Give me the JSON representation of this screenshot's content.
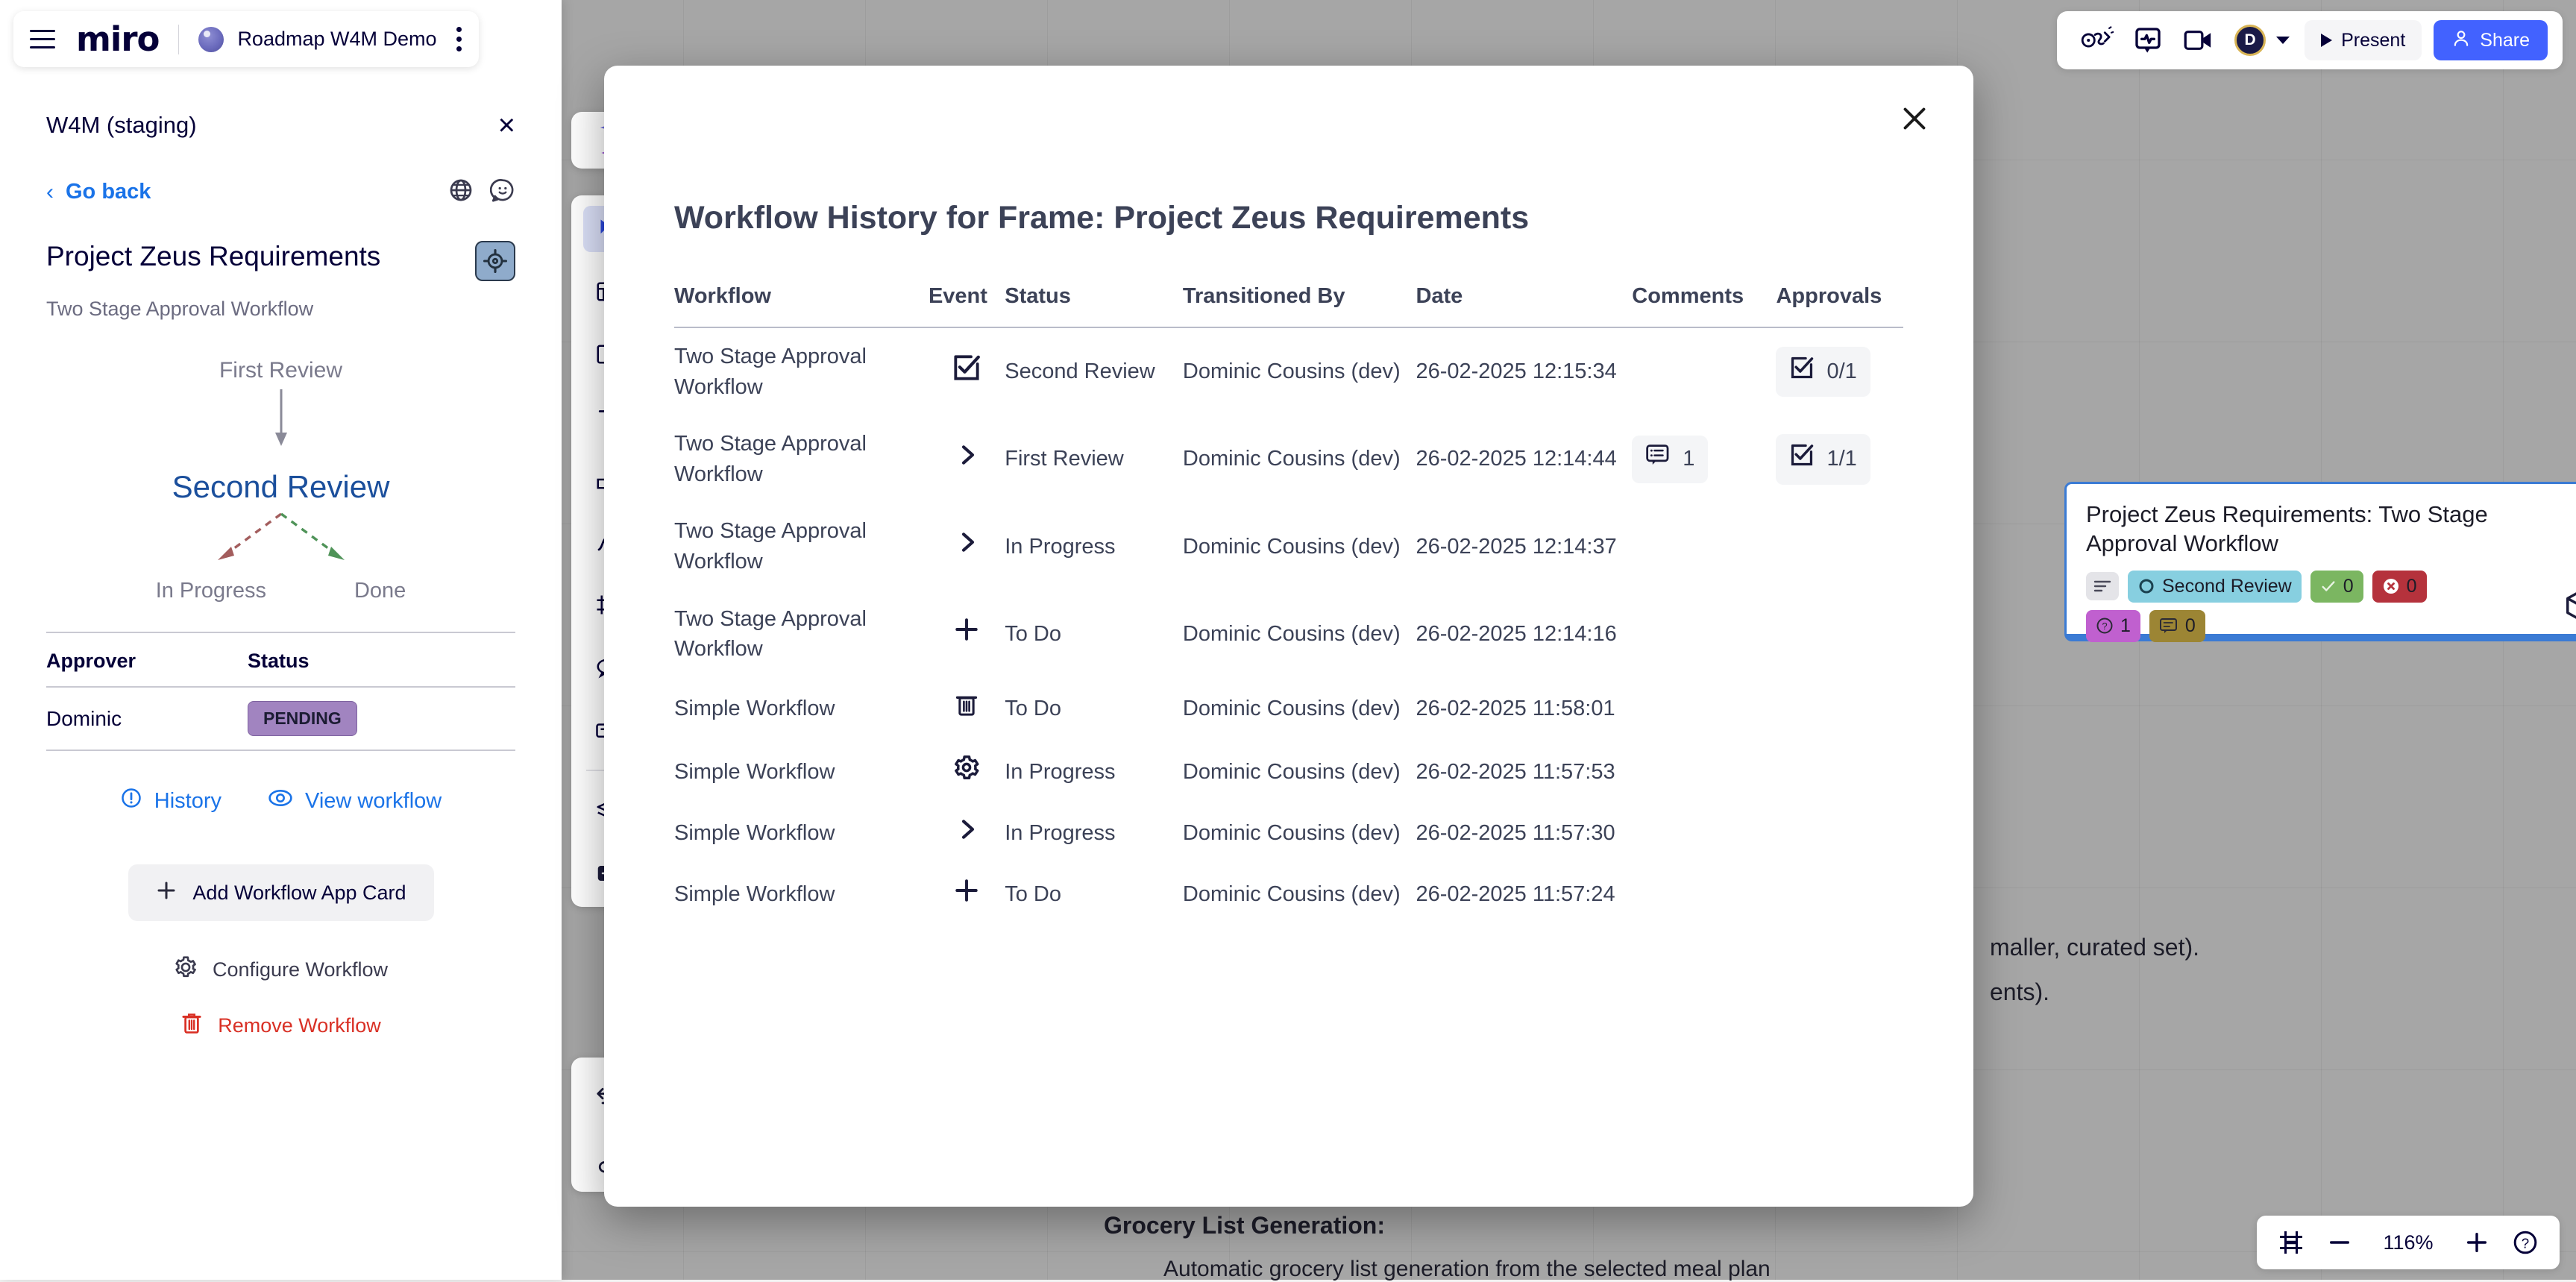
{
  "topbar": {
    "logo": "miro",
    "board_title": "Roadmap W4M Demo",
    "user_initial": "D",
    "present_label": "Present",
    "share_label": "Share",
    "icons": [
      "hamburger-icon",
      "board-thumbnail-icon",
      "kebab-menu-icon",
      "celebration-icon",
      "activity-comment-icon",
      "video-call-icon",
      "avatar",
      "chevron-down-icon",
      "play-icon",
      "person-icon"
    ]
  },
  "sidebar": {
    "app_title": "W4M (staging)",
    "close_icon": "×",
    "go_back": "Go back",
    "frame_title": "Project Zeus Requirements",
    "workflow_name": "Two Stage Approval Workflow",
    "flow": {
      "previous_state": "First Review",
      "current_state": "Second Review",
      "next_states": [
        "In Progress",
        "Done"
      ]
    },
    "approver_table": {
      "headers": [
        "Approver",
        "Status"
      ],
      "rows": [
        {
          "approver": "Dominic",
          "status": "PENDING"
        }
      ]
    },
    "links": [
      {
        "label": "History",
        "icon": "info-circle-icon"
      },
      {
        "label": "View workflow",
        "icon": "eye-icon"
      }
    ],
    "actions": [
      {
        "label": "Add Workflow App Card",
        "icon": "plus-icon"
      },
      {
        "label": "Configure Workflow",
        "icon": "gear-icon"
      },
      {
        "label": "Remove Workflow",
        "icon": "trash-icon"
      }
    ],
    "header_icons": [
      "globe-icon",
      "smiley-chat-icon",
      "target-icon"
    ]
  },
  "modal": {
    "title": "Workflow History for Frame: Project Zeus Requirements",
    "close_icon": "close-icon",
    "columns": [
      "Workflow",
      "Event",
      "Status",
      "Transitioned By",
      "Date",
      "Comments",
      "Approvals"
    ],
    "rows": [
      {
        "workflow": "Two Stage Approval Workflow",
        "event_icon": "checkbox-checked-icon",
        "status": "Second Review",
        "transitioned_by": "Dominic Cousins (dev)",
        "date": "26-02-2025 12:15:34",
        "comments": "",
        "approvals": "0/1"
      },
      {
        "workflow": "Two Stage Approval Workflow",
        "event_icon": "chevron-right-icon",
        "status": "First Review",
        "transitioned_by": "Dominic Cousins (dev)",
        "date": "26-02-2025 12:14:44",
        "comments": "1",
        "approvals": "1/1"
      },
      {
        "workflow": "Two Stage Approval Workflow",
        "event_icon": "chevron-right-icon",
        "status": "In Progress",
        "transitioned_by": "Dominic Cousins (dev)",
        "date": "26-02-2025 12:14:37",
        "comments": "",
        "approvals": ""
      },
      {
        "workflow": "Two Stage Approval Workflow",
        "event_icon": "plus-icon",
        "status": "To Do",
        "transitioned_by": "Dominic Cousins (dev)",
        "date": "26-02-2025 12:14:16",
        "comments": "",
        "approvals": ""
      },
      {
        "workflow": "Simple Workflow",
        "event_icon": "trash-icon",
        "status": "To Do",
        "transitioned_by": "Dominic Cousins (dev)",
        "date": "26-02-2025 11:58:01",
        "comments": "",
        "approvals": ""
      },
      {
        "workflow": "Simple Workflow",
        "event_icon": "gear-icon",
        "status": "In Progress",
        "transitioned_by": "Dominic Cousins (dev)",
        "date": "26-02-2025 11:57:53",
        "comments": "",
        "approvals": ""
      },
      {
        "workflow": "Simple Workflow",
        "event_icon": "chevron-right-icon",
        "status": "In Progress",
        "transitioned_by": "Dominic Cousins (dev)",
        "date": "26-02-2025 11:57:30",
        "comments": "",
        "approvals": ""
      },
      {
        "workflow": "Simple Workflow",
        "event_icon": "plus-icon",
        "status": "To Do",
        "transitioned_by": "Dominic Cousins (dev)",
        "date": "26-02-2025 11:57:24",
        "comments": "",
        "approvals": ""
      }
    ]
  },
  "app_card": {
    "title": "Project Zeus Requirements: Two Stage Approval Workflow",
    "status_chip": "Second Review",
    "approved_count": "0",
    "rejected_count": "0",
    "pending_count": "1",
    "comment_count": "0"
  },
  "canvas_text": {
    "line1": "maller, curated set).",
    "line2": "ents).",
    "bullet_title": "Grocery List Generation:",
    "bullet_sub": "Automatic grocery list generation from the selected meal plan"
  },
  "zoombar": {
    "zoom_level": "116%",
    "icons": [
      "fit-frame-icon",
      "minus-icon",
      "plus-icon",
      "help-icon"
    ]
  },
  "colors": {
    "brand_blue": "#4262ff",
    "link_blue": "#1a73e8",
    "current_state": "#1b4f9c",
    "pending": "#a184c0",
    "danger": "#d93025",
    "card_border": "#3b7bd4",
    "status_chip": "#87cfe0",
    "approve_green": "#7bb661",
    "reject_red": "#b5323c",
    "pending_purple": "#c060cf",
    "comment_gold": "#9c8534",
    "avatar_ring": "#d8b455",
    "ink": "#3c4257"
  }
}
